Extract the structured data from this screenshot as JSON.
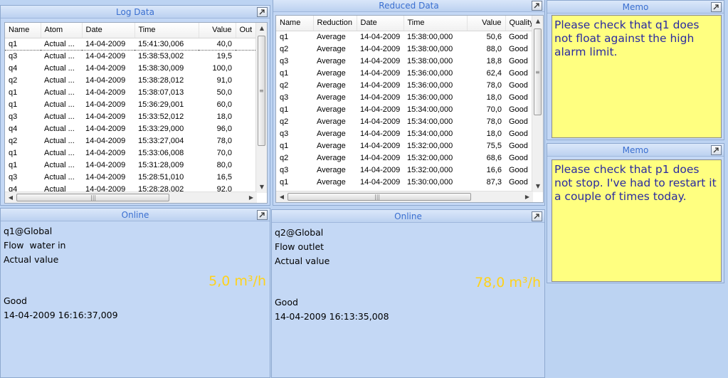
{
  "log_panel": {
    "title": "Log Data",
    "columns": [
      "Name",
      "Atom",
      "Date",
      "Time",
      "Value",
      "Out"
    ],
    "rows": [
      [
        "q1",
        "Actual ...",
        "14-04-2009",
        "15:41:30,006",
        "40,0",
        ""
      ],
      [
        "q3",
        "Actual ...",
        "14-04-2009",
        "15:38:53,002",
        "19,5",
        ""
      ],
      [
        "q4",
        "Actual ...",
        "14-04-2009",
        "15:38:30,009",
        "100,0",
        ""
      ],
      [
        "q2",
        "Actual ...",
        "14-04-2009",
        "15:38:28,012",
        "91,0",
        ""
      ],
      [
        "q1",
        "Actual ...",
        "14-04-2009",
        "15:38:07,013",
        "50,0",
        ""
      ],
      [
        "q1",
        "Actual ...",
        "14-04-2009",
        "15:36:29,001",
        "60,0",
        ""
      ],
      [
        "q3",
        "Actual ...",
        "14-04-2009",
        "15:33:52,012",
        "18,0",
        ""
      ],
      [
        "q4",
        "Actual ...",
        "14-04-2009",
        "15:33:29,000",
        "96,0",
        ""
      ],
      [
        "q2",
        "Actual ...",
        "14-04-2009",
        "15:33:27,004",
        "78,0",
        ""
      ],
      [
        "q1",
        "Actual ...",
        "14-04-2009",
        "15:33:06,008",
        "70,0",
        ""
      ],
      [
        "q1",
        "Actual ...",
        "14-04-2009",
        "15:31:28,009",
        "80,0",
        ""
      ],
      [
        "q3",
        "Actual ...",
        "14-04-2009",
        "15:28:51,010",
        "16,5",
        ""
      ],
      [
        "q4",
        "Actual",
        "14-04-2009",
        "15:28:28,002",
        "92,0",
        ""
      ]
    ]
  },
  "reduced_panel": {
    "title": "Reduced Data",
    "columns": [
      "Name",
      "Reduction",
      "Date",
      "Time",
      "Value",
      "Quality"
    ],
    "rows": [
      [
        "q1",
        "Average",
        "14-04-2009",
        "15:38:00,000",
        "50,6",
        "Good"
      ],
      [
        "q2",
        "Average",
        "14-04-2009",
        "15:38:00,000",
        "88,0",
        "Good"
      ],
      [
        "q3",
        "Average",
        "14-04-2009",
        "15:38:00,000",
        "18,8",
        "Good"
      ],
      [
        "q1",
        "Average",
        "14-04-2009",
        "15:36:00,000",
        "62,4",
        "Good"
      ],
      [
        "q2",
        "Average",
        "14-04-2009",
        "15:36:00,000",
        "78,0",
        "Good"
      ],
      [
        "q3",
        "Average",
        "14-04-2009",
        "15:36:00,000",
        "18,0",
        "Good"
      ],
      [
        "q1",
        "Average",
        "14-04-2009",
        "15:34:00,000",
        "70,0",
        "Good"
      ],
      [
        "q2",
        "Average",
        "14-04-2009",
        "15:34:00,000",
        "78,0",
        "Good"
      ],
      [
        "q3",
        "Average",
        "14-04-2009",
        "15:34:00,000",
        "18,0",
        "Good"
      ],
      [
        "q1",
        "Average",
        "14-04-2009",
        "15:32:00,000",
        "75,5",
        "Good"
      ],
      [
        "q2",
        "Average",
        "14-04-2009",
        "15:32:00,000",
        "68,6",
        "Good"
      ],
      [
        "q3",
        "Average",
        "14-04-2009",
        "15:32:00,000",
        "16,6",
        "Good"
      ],
      [
        "q1",
        "Average",
        "14-04-2009",
        "15:30:00,000",
        "87,3",
        "Good"
      ]
    ]
  },
  "memo1": {
    "title": "Memo",
    "text": "Please check that q1 does not float against the high alarm limit."
  },
  "memo2": {
    "title": "Memo",
    "text": "Please check that p1 does not stop. I've had to restart it a couple of times today."
  },
  "online1": {
    "title": "Online",
    "tag": "q1@Global",
    "description": "Flow  water in",
    "atom": "Actual value",
    "value": "5,0 m³/h",
    "quality": "Good",
    "timestamp": "14-04-2009 16:16:37,009"
  },
  "online2": {
    "title": "Online",
    "tag": "q2@Global",
    "description": "Flow outlet",
    "atom": "Actual value",
    "value": "78,0 m³/h",
    "quality": "Good",
    "timestamp": "14-04-2009 16:13:35,008"
  },
  "colors": {
    "panel_bg": "#c4d8f5",
    "title_text": "#3a6fd0",
    "value_text": "#ffd21a",
    "memo_bg": "#ffff80",
    "memo_text": "#2a2aa0"
  },
  "icons": {
    "maximize": "maximize-arrow-icon",
    "scroll_up": "scroll-up-arrow-icon",
    "scroll_down": "scroll-down-arrow-icon",
    "scroll_left": "scroll-left-arrow-icon",
    "scroll_right": "scroll-right-arrow-icon"
  }
}
